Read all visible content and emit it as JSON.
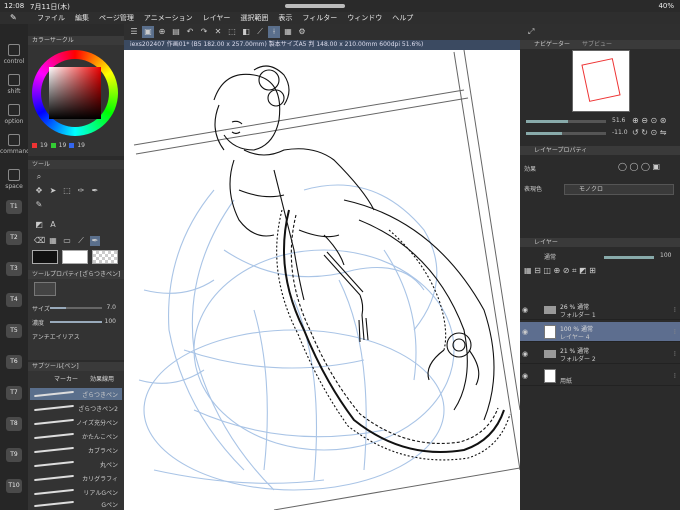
{
  "status": {
    "time": "12:08",
    "date": "7月11日(木)",
    "battery": "40%"
  },
  "menu": [
    "ファイル",
    "編集",
    "ページ管理",
    "アニメーション",
    "レイヤー",
    "選択範囲",
    "表示",
    "フィルター",
    "ウィンドウ",
    "ヘルプ"
  ],
  "modifiers": {
    "control": "control",
    "shift": "shift",
    "option": "option",
    "command": "command",
    "space": "space"
  },
  "tkeys": [
    "T1",
    "T2",
    "T3",
    "T4",
    "T5",
    "T6",
    "T7",
    "T8",
    "T9",
    "T10"
  ],
  "color_panel": {
    "title": "カラーサークル",
    "r": "19",
    "g": "19",
    "b": "19"
  },
  "tool_panel": {
    "title": "ツール"
  },
  "tool_property": {
    "title": "ツールプロパティ[ざらつきペン]",
    "size_label": "サイズ",
    "size_value": "7.0",
    "density_label": "濃度",
    "density_value": "100",
    "ab_label": "アンチエイリアス"
  },
  "subtool": {
    "title": "サブツール[ペン]",
    "tabs": [
      "マーカー",
      "効果線用"
    ],
    "brushes": [
      "ざらつきペン",
      "ざらつきペン2",
      "ノイズ充分ペン",
      "かたんこペン",
      "カブラペン",
      "丸ペン",
      "カリグラフィ",
      "リアルGペン",
      "Gペン"
    ],
    "selected_index": 0
  },
  "document": {
    "tab": "iexs202407 作画01* (B5 182.00 x 257.00mm) 製本サイズA5 判 148.00 x 210.00mm 600dpi 51.6%)"
  },
  "navigator": {
    "title": "ナビゲーター",
    "sub": "サブビュー",
    "zoom": "51.6",
    "angle": "-11.0"
  },
  "layer_property": {
    "title": "レイヤープロパティ",
    "effect_label": "効果",
    "express_label": "表現色",
    "express_value": "モノクロ"
  },
  "layers_panel": {
    "title": "レイヤー",
    "blend": "通常",
    "opacity": "100",
    "rows": [
      {
        "line1": "26 % 通常",
        "line2": "フォルダー 1",
        "type": "folder",
        "selected": false
      },
      {
        "line1": "100 % 通常",
        "line2": "レイヤー 4",
        "type": "layer",
        "selected": true
      },
      {
        "line1": "21 % 通常",
        "line2": "フォルダー 2",
        "type": "folder",
        "selected": false
      },
      {
        "line1": "",
        "line2": "用紙",
        "type": "paper",
        "selected": false
      }
    ]
  }
}
